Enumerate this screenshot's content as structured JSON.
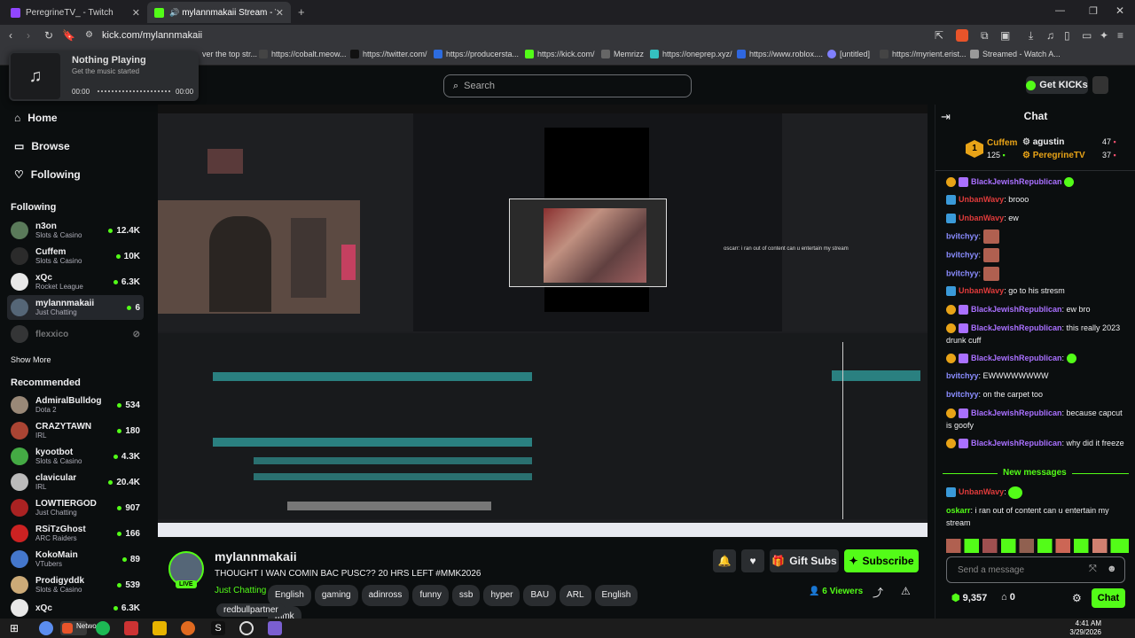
{
  "browser": {
    "tabs": [
      {
        "title": "PeregrineTV_ - Twitch",
        "fav_color": "#9146ff"
      },
      {
        "title": "mylannmakaii Stream - Watc",
        "fav_color": "#53fc18"
      }
    ],
    "new_tab": "+",
    "url": "kick.com/mylannmakaii",
    "bookmarks": [
      {
        "label": "ver the top str...",
        "color": "#888"
      },
      {
        "label": "https://cobalt.meow...",
        "color": "#444"
      },
      {
        "label": "https://twitter.com/",
        "color": "#111"
      },
      {
        "label": "https://producersta...",
        "color": "#2d6cdf"
      },
      {
        "label": "https://kick.com/",
        "color": "#53fc18"
      },
      {
        "label": "Memrizz",
        "color": "#666"
      },
      {
        "label": "https://oneprep.xyz/",
        "color": "#35c0c0"
      },
      {
        "label": "https://www.roblox....",
        "color": "#2f67e0"
      },
      {
        "label": "[untitled]",
        "color": "#8080ff"
      },
      {
        "label": "https://myrient.erist...",
        "color": "#444"
      },
      {
        "label": "Streamed - Watch A...",
        "color": "#999"
      }
    ]
  },
  "music": {
    "title": "Nothing Playing",
    "subtitle": "Get the music started",
    "time_start": "00:00",
    "time_end": "00:00"
  },
  "header": {
    "search_placeholder": "Search",
    "get_kicks": "Get KICKs"
  },
  "sidebar": {
    "nav": [
      {
        "label": "Home",
        "icon": "home-icon"
      },
      {
        "label": "Browse",
        "icon": "browse-icon"
      },
      {
        "label": "Following",
        "icon": "heart-icon"
      }
    ],
    "following_title": "Following",
    "following": [
      {
        "name": "n3on",
        "cat": "Slots & Casino",
        "viewers": "12.4K",
        "color": "#5a7a5a"
      },
      {
        "name": "Cuffem",
        "cat": "Slots & Casino",
        "viewers": "10K",
        "color": "#2b2b2b"
      },
      {
        "name": "xQc",
        "cat": "Rocket League",
        "viewers": "6.3K",
        "color": "#e8e8e8"
      },
      {
        "name": "mylannmakaii",
        "cat": "Just Chatting",
        "viewers": "6",
        "color": "#556677"
      },
      {
        "name": "flexxico",
        "cat": "",
        "viewers": "",
        "color": "#666"
      }
    ],
    "show_more": "Show More",
    "recommended_title": "Recommended",
    "recommended": [
      {
        "name": "AdmiralBulldog",
        "cat": "Dota 2",
        "viewers": "534",
        "color": "#998877"
      },
      {
        "name": "CRAZYTAWN",
        "cat": "IRL",
        "viewers": "180",
        "color": "#aa4433"
      },
      {
        "name": "kyootbot",
        "cat": "Slots & Casino",
        "viewers": "4.3K",
        "color": "#44aa44"
      },
      {
        "name": "clavicular",
        "cat": "IRL",
        "viewers": "20.4K",
        "color": "#bbbbbb"
      },
      {
        "name": "LOWTIERGOD",
        "cat": "Just Chatting",
        "viewers": "907",
        "color": "#aa2222"
      },
      {
        "name": "RSiTzGhost",
        "cat": "ARC Raiders",
        "viewers": "166",
        "color": "#cc2222"
      },
      {
        "name": "KokoMain",
        "cat": "VTubers",
        "viewers": "89",
        "color": "#4477cc"
      },
      {
        "name": "Prodigyddk",
        "cat": "Slots & Casino",
        "viewers": "539",
        "color": "#ccaa77"
      },
      {
        "name": "xQc",
        "cat": "",
        "viewers": "6.3K",
        "color": "#e8e8e8"
      }
    ]
  },
  "video": {
    "overlay_text": "oscarr: i ran out of content can u entertain my stream"
  },
  "stream": {
    "channel": "mylannmakaii",
    "live": "LIVE",
    "title": "THOUGHT I WAN COMIN BAC PUSC?? 20 HRS LEFT #MMK2026",
    "category": "Just Chatting",
    "tags": [
      "English",
      "gaming",
      "adinross",
      "funny",
      "ssb",
      "hyper",
      "BAU",
      "ARL",
      "English",
      "mmk",
      "redbullpartner"
    ],
    "gift_subs": "Gift Subs",
    "subscribe": "Subscribe",
    "viewers": "6 Viewers"
  },
  "chat": {
    "title": "Chat",
    "leaderboard": [
      {
        "name": "Cuffem",
        "points": "125",
        "color": "#e8a317"
      },
      {
        "name": "agustin",
        "points": "47",
        "color": "#efeff1"
      },
      {
        "name": "PeregrineTV",
        "points": "37",
        "color": "#e8a317"
      }
    ],
    "messages": [
      {
        "user": "BlackJewishRepublican",
        "text": "",
        "color": "#a970ff",
        "emote": true
      },
      {
        "user": "UnbanWavy",
        "text": ": brooo",
        "color": "#e03b3b"
      },
      {
        "user": "UnbanWavy",
        "text": ": ew",
        "color": "#e03b3b"
      },
      {
        "user": "bvitchyy",
        "text": ":",
        "color": "#8a8cff",
        "img": true
      },
      {
        "user": "bvitchyy",
        "text": ":",
        "color": "#8a8cff",
        "img": true
      },
      {
        "user": "bvitchyy",
        "text": ":",
        "color": "#8a8cff",
        "img": true
      },
      {
        "user": "UnbanWavy",
        "text": ": go to his stresm",
        "color": "#e03b3b"
      },
      {
        "user": "BlackJewishRepublican",
        "text": ": ew bro",
        "color": "#a970ff"
      },
      {
        "user": "BlackJewishRepublican",
        "text": ": this really 2023 drunk cuff",
        "color": "#a970ff"
      },
      {
        "user": "BlackJewishRepublican",
        "text": ":",
        "color": "#a970ff",
        "emote": true
      },
      {
        "user": "bvitchyy",
        "text": ": EWWWWWWWW",
        "color": "#8a8cff"
      },
      {
        "user": "bvitchyy",
        "text": ": on the carpet too",
        "color": "#8a8cff"
      },
      {
        "user": "BlackJewishRepublican",
        "text": ": because capcut is goofy",
        "color": "#a970ff"
      },
      {
        "user": "BlackJewishRepublican",
        "text": ": why did it freeze",
        "color": "#a970ff"
      }
    ],
    "new_messages": "New messages",
    "new": [
      {
        "user": "UnbanWavy",
        "text": ":",
        "color": "#e03b3b",
        "emote": true
      },
      {
        "user": "oskarr",
        "text": ": i ran out of content can u entertain my stream",
        "color": "#53fc18"
      }
    ],
    "input_placeholder": "Send a message",
    "kicks": "9,357",
    "gifts": "0",
    "chat_button": "Chat"
  },
  "taskbar": {
    "time": "4:41 AM",
    "date": "3/29/2026",
    "network": "Network"
  }
}
